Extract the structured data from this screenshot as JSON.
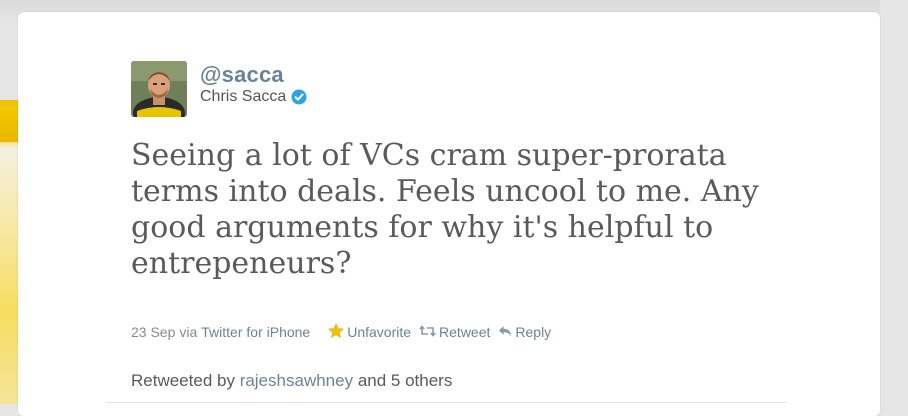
{
  "tweet": {
    "handle": "@sacca",
    "display_name": "Chris Sacca",
    "verified": true,
    "text": "Seeing a lot of VCs cram super-prorata terms into deals. Feels uncool to me. Any good arguments for why it's helpful to entrepeneurs?",
    "date": "23 Sep",
    "via_prefix": "via",
    "source": "Twitter for iPhone"
  },
  "actions": {
    "unfavorite": "Unfavorite",
    "retweet": "Retweet",
    "reply": "Reply"
  },
  "retweeted": {
    "prefix": "Retweeted by",
    "user": "rajeshsawhney",
    "suffix": "and 5 others"
  },
  "icons": {
    "avatar": "user-photo",
    "verified": "verified-badge-icon",
    "favorite": "star-icon",
    "retweet": "retweet-icon",
    "reply": "reply-arrow-icon"
  },
  "colors": {
    "link": "#6b8399",
    "star": "#f2c200",
    "verified": "#2aa3e8",
    "text": "#5a5a5a"
  }
}
